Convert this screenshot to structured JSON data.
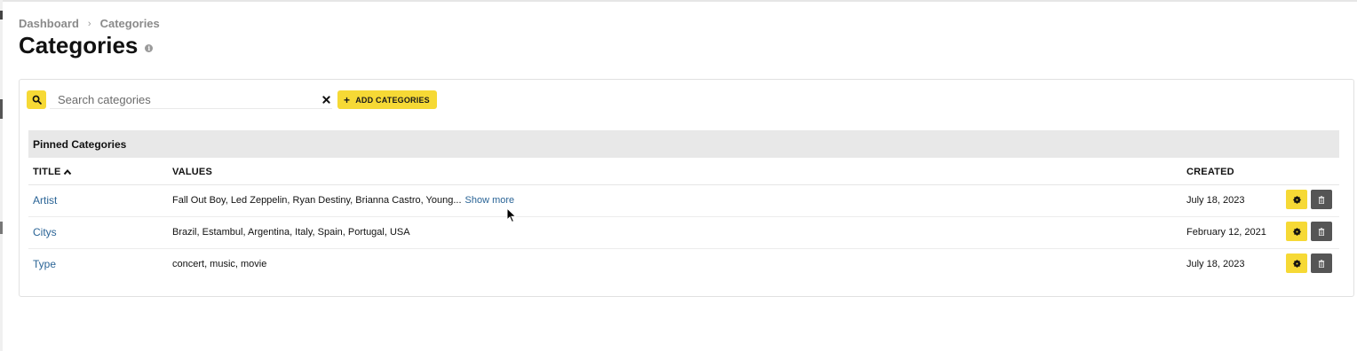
{
  "breadcrumb": {
    "home": "Dashboard",
    "separator": "›",
    "current": "Categories"
  },
  "page": {
    "title": "Categories",
    "info_icon": "info-icon"
  },
  "toolbar": {
    "search_placeholder": "Search categories",
    "search_value": "",
    "add_label": "ADD CATEGORIES",
    "add_icon": "+",
    "accent_color": "#f6d935"
  },
  "section": {
    "title": "Pinned Categories"
  },
  "table": {
    "columns": {
      "title": "TITLE",
      "values": "VALUES",
      "created": "CREATED"
    },
    "sort_column": "TITLE",
    "sort_direction": "ascending",
    "show_more_label": "Show more",
    "rows": [
      {
        "title": "Artist",
        "values": "Fall Out Boy, Led Zeppelin, Ryan Destiny, Brianna Castro, Young...",
        "created": "July 18, 2023",
        "truncated": true
      },
      {
        "title": "Citys",
        "values": "Brazil, Estambul, Argentina, Italy, Spain, Portugal, USA",
        "created": "February 12, 2021",
        "truncated": false
      },
      {
        "title": "Type",
        "values": "concert, music, movie",
        "created": "July 18, 2023",
        "truncated": false
      }
    ]
  },
  "colors": {
    "link": "#2a6496",
    "delete_button": "#555555",
    "section_header_bg": "#e8e8e8"
  }
}
